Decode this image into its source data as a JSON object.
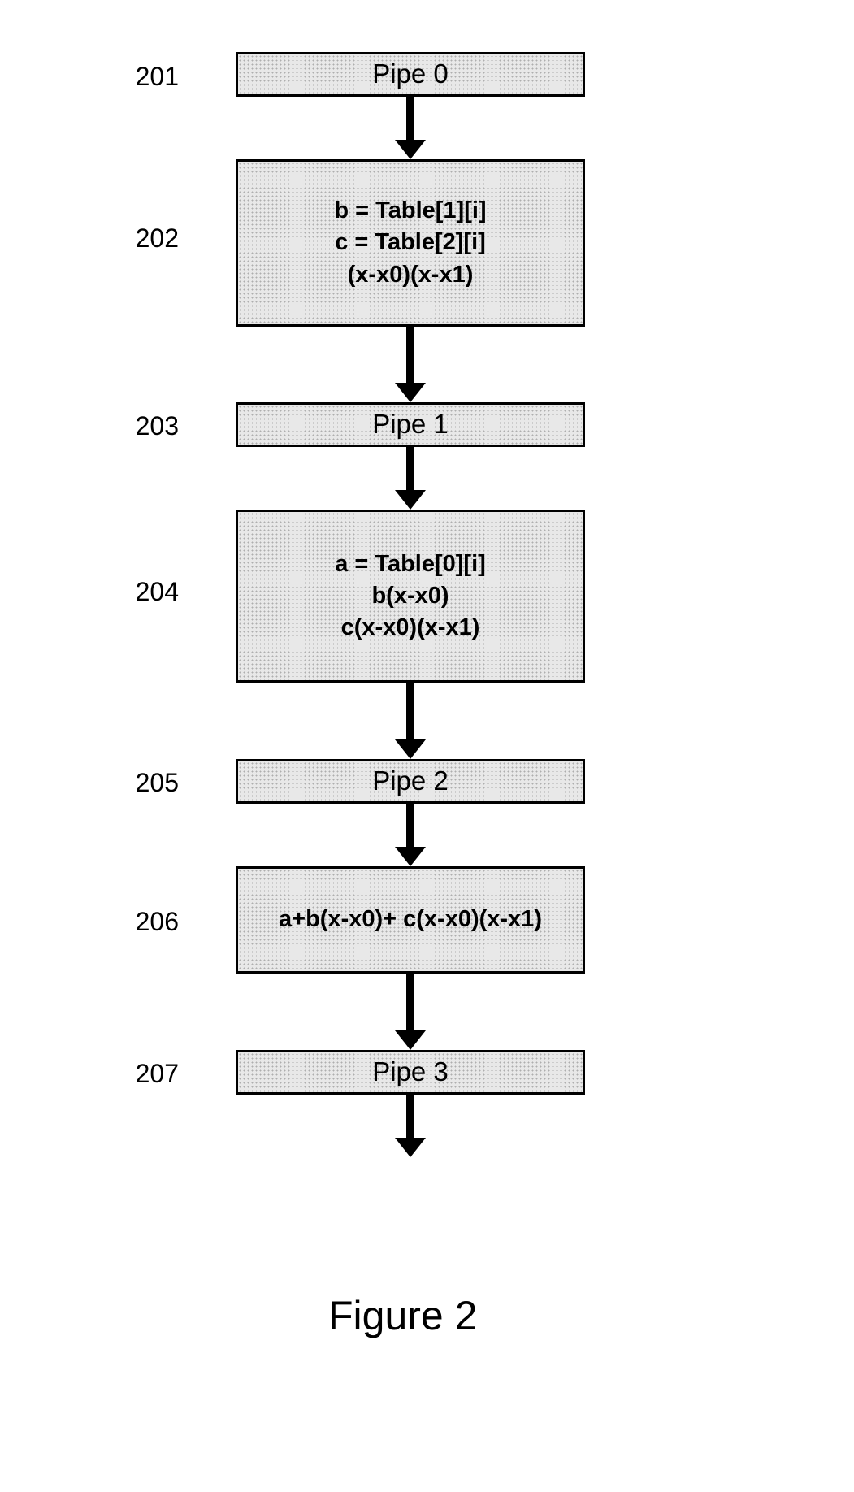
{
  "figure_caption": "Figure 2",
  "labels": {
    "l201": "201",
    "l202": "202",
    "l203": "203",
    "l204": "204",
    "l205": "205",
    "l206": "206",
    "l207": "207"
  },
  "boxes": {
    "pipe0": "Pipe 0",
    "stage202_line1": "b = Table[1][i]",
    "stage202_line2": "c = Table[2][i]",
    "stage202_line3": "(x-x0)(x-x1)",
    "pipe1": "Pipe 1",
    "stage204_line1": "a = Table[0][i]",
    "stage204_line2": "b(x-x0)",
    "stage204_line3": "c(x-x0)(x-x1)",
    "pipe2": "Pipe 2",
    "stage206_line1": "a+b(x-x0)+ c(x-x0)(x-x1)",
    "pipe3": "Pipe 3"
  }
}
